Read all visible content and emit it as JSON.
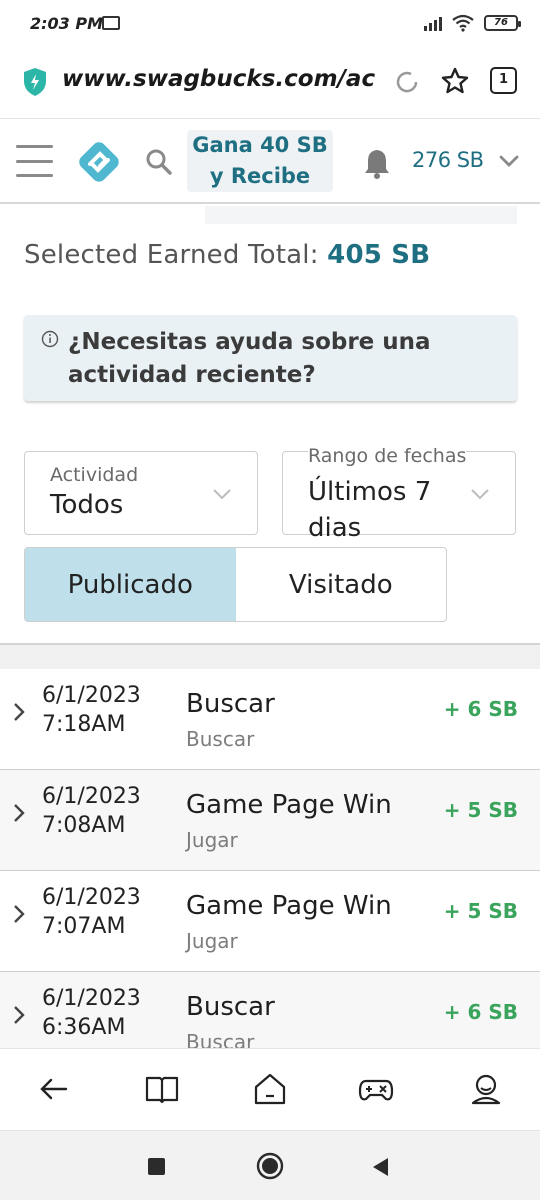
{
  "status_bar": {
    "time": "2:03 PM",
    "battery": "76"
  },
  "browser": {
    "url": "www.swagbucks.com/acc",
    "tab_count": "1"
  },
  "site_header": {
    "promo_line1": "Gana 40 SB",
    "promo_line2": "y Recibe",
    "balance": "276 SB"
  },
  "summary": {
    "label": "Selected Earned Total:",
    "value": "405 SB"
  },
  "help_banner": {
    "text": "¿Necesitas ayuda sobre una actividad reciente?"
  },
  "filters": {
    "activity": {
      "label": "Actividad",
      "value": "Todos"
    },
    "date_range": {
      "label": "Rango de fechas",
      "value": "Últimos 7 dias"
    }
  },
  "toggle": {
    "options": [
      "Publicado",
      "Visitado"
    ],
    "selected": "Publicado"
  },
  "activities": [
    {
      "date": "6/1/2023",
      "time": "7:18AM",
      "title": "Buscar",
      "category": "Buscar",
      "amount": "+ 6 SB"
    },
    {
      "date": "6/1/2023",
      "time": "7:08AM",
      "title": "Game Page Win",
      "category": "Jugar",
      "amount": "+ 5 SB"
    },
    {
      "date": "6/1/2023",
      "time": "7:07AM",
      "title": "Game Page Win",
      "category": "Jugar",
      "amount": "+ 5 SB"
    },
    {
      "date": "6/1/2023",
      "time": "6:36AM",
      "title": "Buscar",
      "category": "Buscar",
      "amount": "+ 6 SB"
    }
  ],
  "bottom_nav": [
    "back-arrow-icon",
    "book-icon",
    "home-icon",
    "gamepad-icon",
    "profile-icon"
  ],
  "colors": {
    "accent": "#1f6f82",
    "positive": "#3aa35c",
    "toggle_active": "#bfe0ea",
    "help_bg": "#e9f1f5"
  }
}
